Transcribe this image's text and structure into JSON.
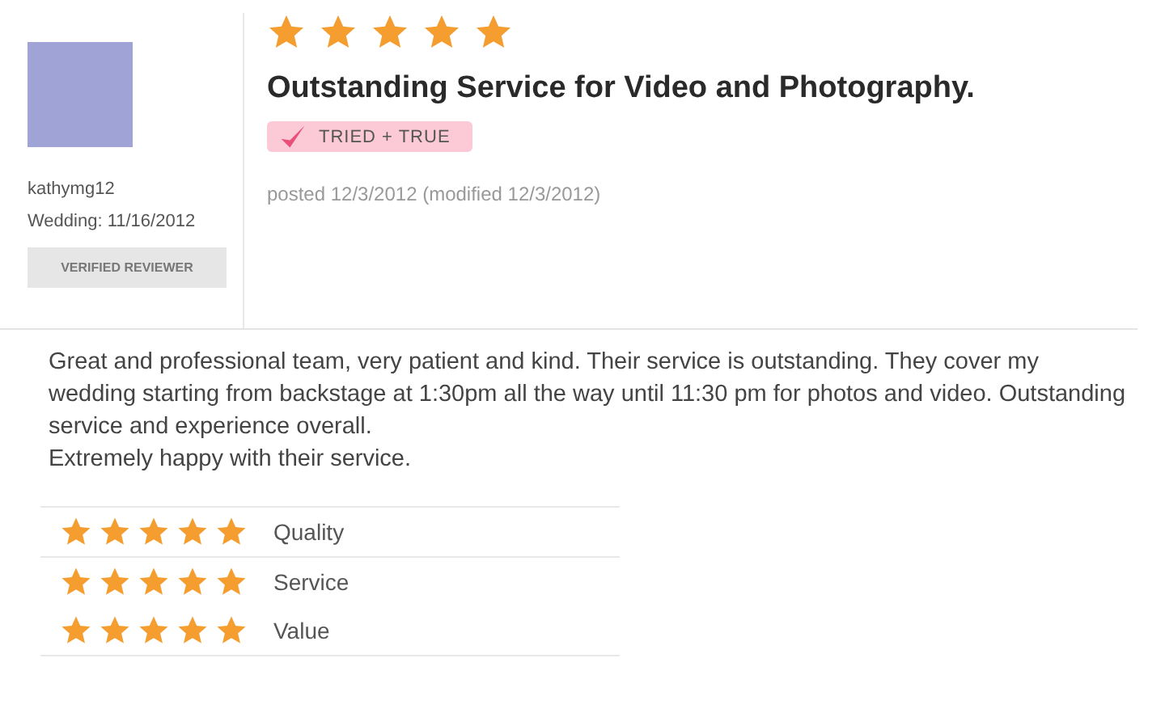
{
  "reviewer": {
    "username": "kathymg12",
    "wedding": "Wedding: 11/16/2012",
    "badge": "VERIFIED REVIEWER"
  },
  "review": {
    "stars": 5,
    "title": "Outstanding Service for Video and Photography.",
    "tag": "TRIED + TRUE",
    "posted": "posted 12/3/2012 (modified 12/3/2012)",
    "body": [
      "Great and professional team, very patient and kind. Their service is outstanding. They cover my wedding starting from backstage at 1:30pm all the way until 11:30 pm for photos and video. Outstanding service and experience overall.",
      "Extremely happy with their service."
    ]
  },
  "ratings": [
    {
      "label": "Quality",
      "stars": 5
    },
    {
      "label": "Service",
      "stars": 5
    },
    {
      "label": "Value",
      "stars": 5
    }
  ]
}
